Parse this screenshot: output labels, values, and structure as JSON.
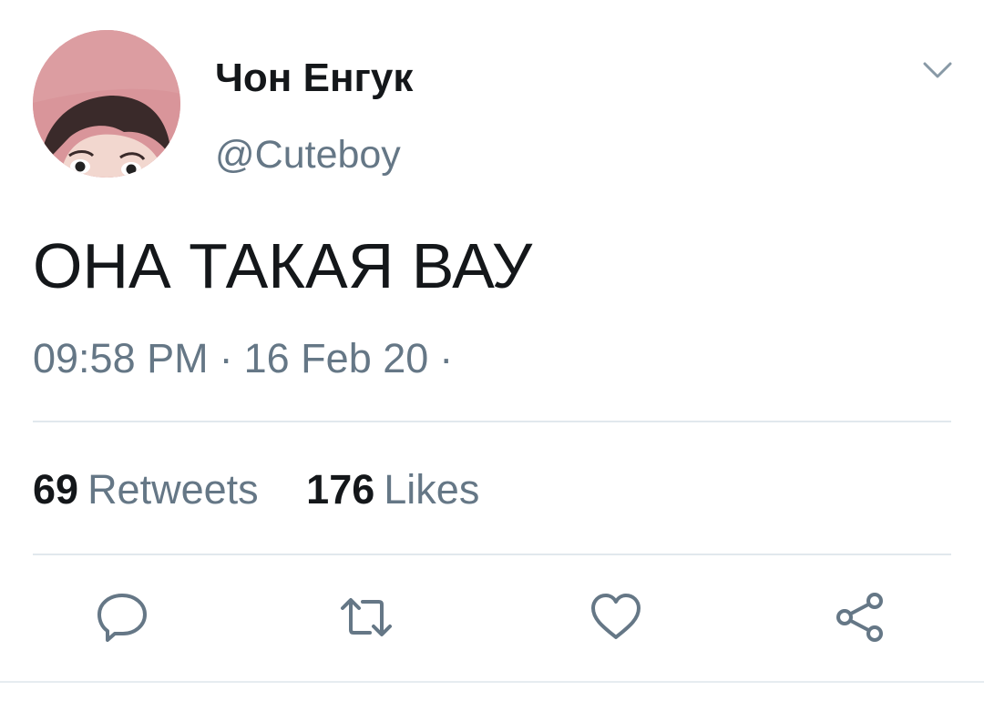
{
  "author": {
    "display_name": "Чон Енгук",
    "handle": "@Cuteboy"
  },
  "tweet": {
    "text": "ОНА ТАКАЯ ВАУ",
    "time": "09:58 PM",
    "separator": "·",
    "date": "16 Feb 20",
    "trailing_separator": "·"
  },
  "stats": {
    "retweets_count": "69",
    "retweets_label": "Retweets",
    "likes_count": "176",
    "likes_label": "Likes"
  },
  "actions": {
    "reply_icon": "reply-icon",
    "retweet_icon": "retweet-icon",
    "like_icon": "heart-icon",
    "share_icon": "share-icon"
  },
  "colors": {
    "text_primary": "#14171a",
    "text_secondary": "#657786",
    "divider": "#e1e8ed",
    "avatar_background": "#d9959a"
  }
}
